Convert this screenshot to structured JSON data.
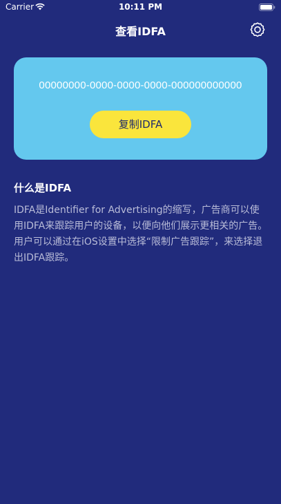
{
  "status_bar": {
    "carrier": "Carrier",
    "time": "10:11 PM",
    "icons": [
      "wifi-icon",
      "battery-icon"
    ]
  },
  "nav": {
    "title": "查看IDFA",
    "settings_icon": "gear-icon"
  },
  "idfa_card": {
    "value": "00000000-0000-0000-0000-000000000000",
    "copy_button_label": "复制IDFA"
  },
  "info": {
    "heading": "什么是IDFA",
    "body": "IDFA是Identifier for Advertising的缩写，广告商可以使用IDFA来跟踪用户的设备，以便向他们展示更相关的广告。用户可以通过在iOS设置中选择“限制广告跟踪”，来选择退出IDFA跟踪。"
  },
  "colors": {
    "background": "#212b7c",
    "card": "#64c8ee",
    "button": "#fae53c",
    "button_text": "#1f2a6b",
    "body_text": "#b9bcd8"
  }
}
